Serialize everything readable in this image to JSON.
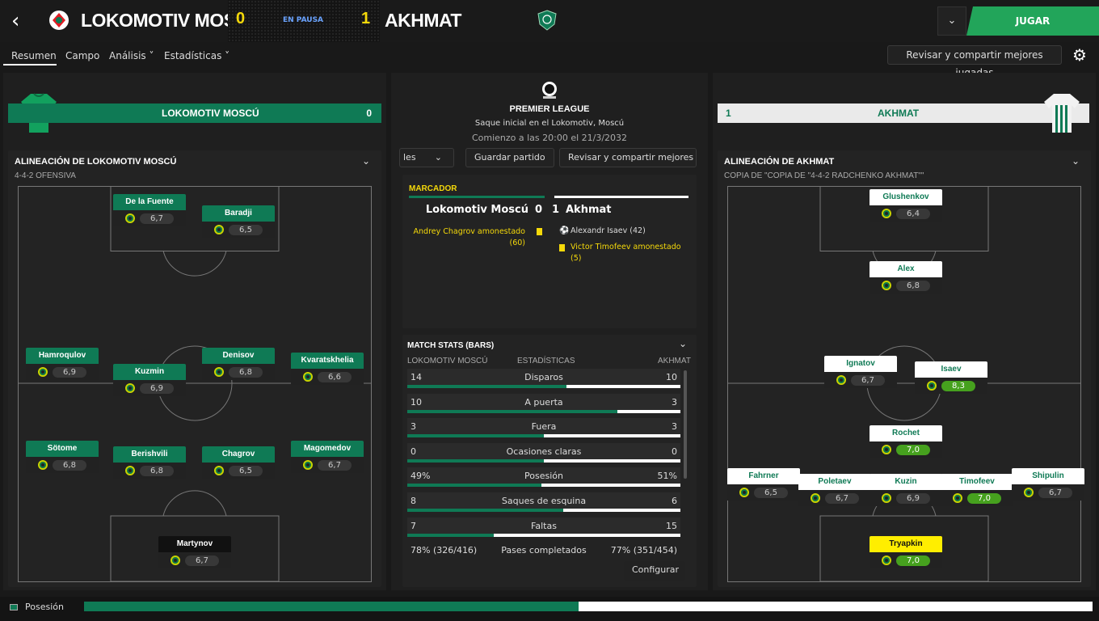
{
  "header": {
    "home_team": "LOKOMOTIV MOS…",
    "away_team": "AKHMAT",
    "home_score": "0",
    "away_score": "1",
    "status": "EN PAUSA",
    "play_label": "JUGAR",
    "back_icon": "back-arrow-icon",
    "dropdown_icon": "chevron-down-icon"
  },
  "nav": {
    "items": [
      "Resumen",
      "Campo",
      "Análisis ˅",
      "Estadísticas ˅"
    ],
    "review_label": "Revisar y compartir mejores jugadas",
    "settings_icon": "gear-icon"
  },
  "home": {
    "name": "LOKOMOTIV MOSCÚ",
    "score": "0",
    "color": "#0f7a55",
    "lineup_title": "ALINEACIÓN DE LOKOMOTIV MOSCÚ",
    "formation": "4-4-2 OFENSIVA",
    "players": [
      {
        "name": "De la Fuente",
        "rating": "6,7"
      },
      {
        "name": "Baradji",
        "rating": "6,5"
      },
      {
        "name": "Hamroqulov",
        "rating": "6,9"
      },
      {
        "name": "Kuzmin",
        "rating": "6,9"
      },
      {
        "name": "Denisov",
        "rating": "6,8"
      },
      {
        "name": "Kvaratskhelia",
        "rating": "6,6"
      },
      {
        "name": "Sötome",
        "rating": "6,8"
      },
      {
        "name": "Berishvili",
        "rating": "6,8"
      },
      {
        "name": "Chagrov",
        "rating": "6,5"
      },
      {
        "name": "Magomedov",
        "rating": "6,7"
      },
      {
        "name": "Martynov",
        "rating": "6,7"
      }
    ]
  },
  "away": {
    "name": "AKHMAT",
    "score": "1",
    "lineup_title": "ALINEACIÓN DE AKHMAT",
    "formation": "COPIA DE \"COPIA DE \"4-4-2 RADCHENKO AKHMAT\"\"",
    "players": [
      {
        "name": "Glushenkov",
        "rating": "6,4"
      },
      {
        "name": "Alex",
        "rating": "6,8"
      },
      {
        "name": "Ignatov",
        "rating": "6,7"
      },
      {
        "name": "Isaev",
        "rating": "8,3"
      },
      {
        "name": "Rochet",
        "rating": "7,0"
      },
      {
        "name": "Fahrner",
        "rating": "6,5"
      },
      {
        "name": "Poletaev",
        "rating": "6,7"
      },
      {
        "name": "Kuzin",
        "rating": "6,9"
      },
      {
        "name": "Timofeev",
        "rating": "7,0"
      },
      {
        "name": "Shipulin",
        "rating": "6,7"
      },
      {
        "name": "Tryapkin",
        "rating": "7,0"
      }
    ]
  },
  "center": {
    "competition": "PREMIER LEAGUE",
    "venue": "Saque inicial en el Lokomotiv, Moscú",
    "kickoff": "Comienzo a las 20:00 el 21/3/2032",
    "btn_partial": "les",
    "btn_save": "Guardar partido",
    "btn_review": "Revisar y compartir mejores ju",
    "scoreboard_label": "MARCADOR",
    "home_line": "Lokomotiv Moscú",
    "away_line": "Akhmat",
    "home_events": [
      "Andrey Chagrov amonestado",
      "(60)"
    ],
    "away_events": [
      {
        "text": "Alexandr Isaev (42)",
        "icon": "football-icon"
      },
      {
        "text": "Victor Timofeev amonestado",
        "icon": "yellow-card-icon"
      },
      {
        "text": "(5)"
      }
    ],
    "stats_title": "MATCH STATS (BARS)",
    "stats_home": "LOKOMOTIV MOSCÚ",
    "stats_label": "ESTADÍSTICAS",
    "stats_away": "AKHMAT",
    "configure_label": "Configurar"
  },
  "stats": [
    {
      "label": "Disparos",
      "home": "14",
      "away": "10",
      "home_share": 0.583
    },
    {
      "label": "A puerta",
      "home": "10",
      "away": "3",
      "home_share": 0.769
    },
    {
      "label": "Fuera",
      "home": "3",
      "away": "3",
      "home_share": 0.5
    },
    {
      "label": "Ocasiones claras",
      "home": "0",
      "away": "0",
      "home_share": 0.5
    },
    {
      "label": "Posesión",
      "home": "49%",
      "away": "51%",
      "home_share": 0.49
    },
    {
      "label": "Saques de esquina",
      "home": "8",
      "away": "6",
      "home_share": 0.571
    },
    {
      "label": "Faltas",
      "home": "7",
      "away": "15",
      "home_share": 0.318
    },
    {
      "label": "Pases completados",
      "home": "78% (326/416)",
      "away": "77% (351/454)",
      "home_share": null
    }
  ],
  "footer": {
    "label": "Posesión",
    "home_share": 0.49
  }
}
